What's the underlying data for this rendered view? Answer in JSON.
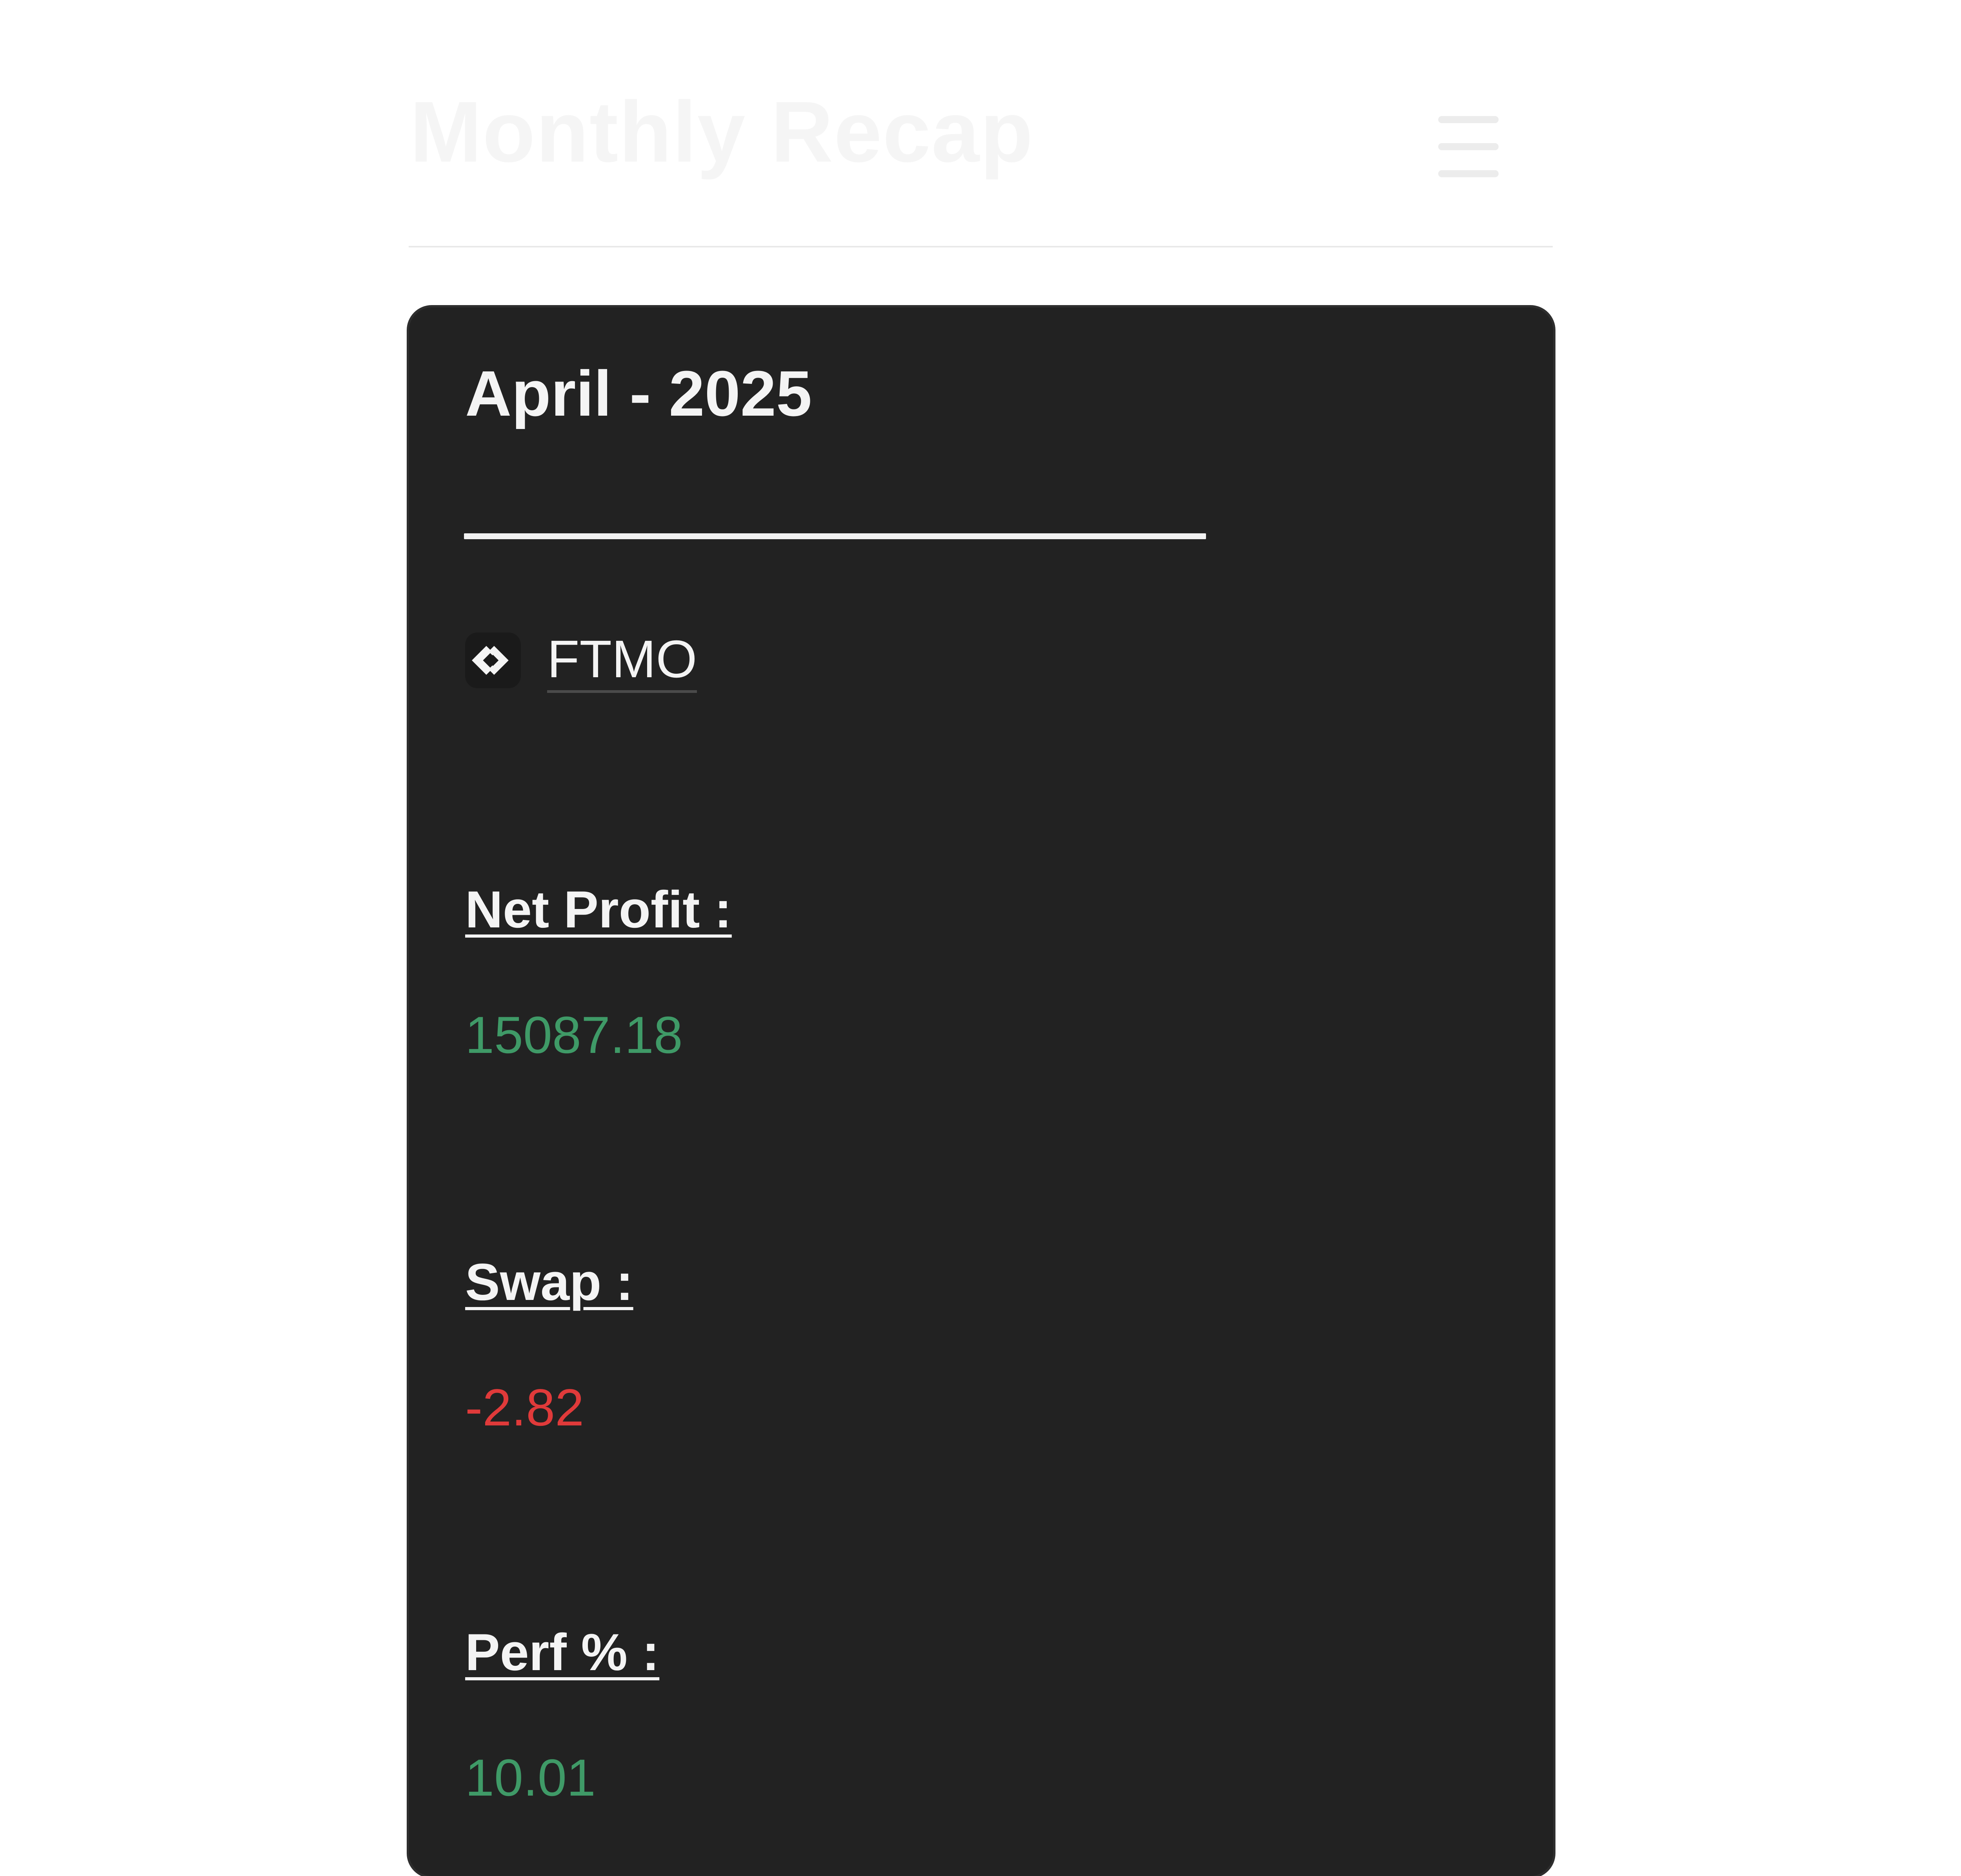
{
  "header": {
    "site_title": "Monthly Recap",
    "menu_icon": "hamburger-menu-icon"
  },
  "card": {
    "title": "April - 2025",
    "broker": {
      "name": "FTMO",
      "icon": "ftmo-logo-icon"
    },
    "metrics": [
      {
        "label": "Net Profit :",
        "value": "15087.18",
        "status": "positive"
      },
      {
        "label": "Swap :",
        "value": "-2.82",
        "status": "negative"
      },
      {
        "label": "Perf % :",
        "value": "10.01",
        "status": "positive"
      }
    ]
  },
  "colors": {
    "card_background": "#222222",
    "positive": "#3f9a67",
    "negative": "#e03a3a",
    "text": "#f4f4f4"
  }
}
